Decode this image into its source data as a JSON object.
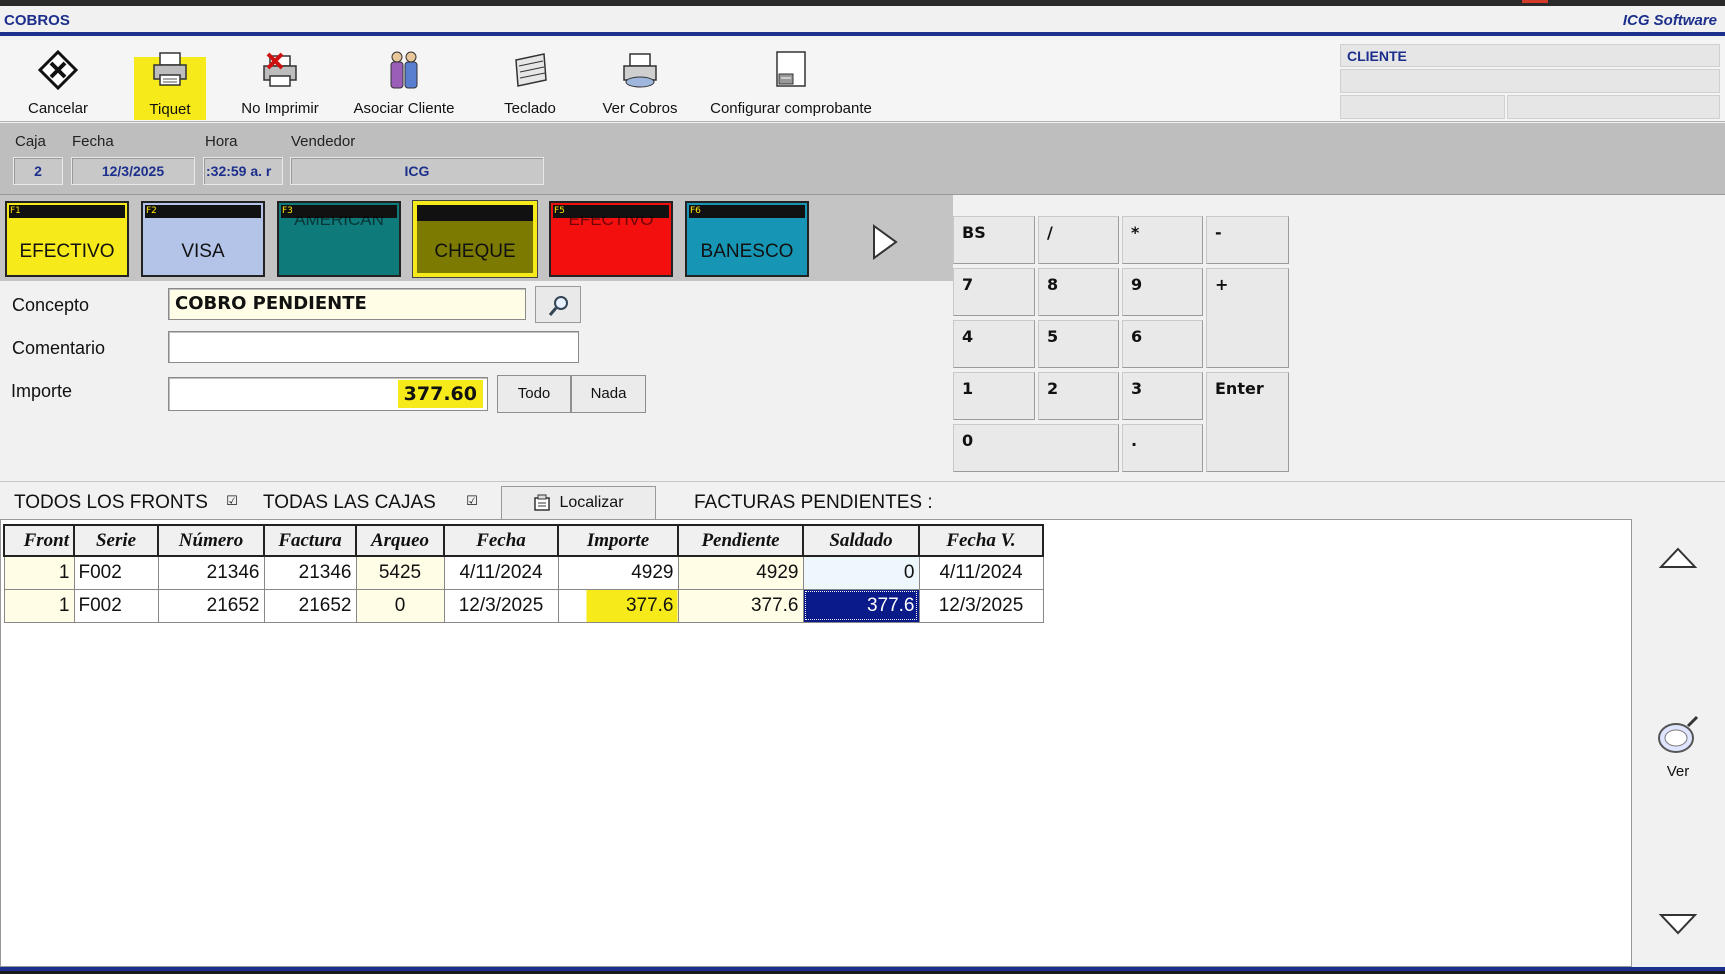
{
  "window": {
    "title": "COBROS",
    "brand": "ICG Software"
  },
  "toolbar": {
    "cancelar": "Cancelar",
    "tiquet": "Tiquet",
    "no_imprimir": "No Imprimir",
    "asociar_cliente": "Asociar Cliente",
    "teclado": "Teclado",
    "ver_cobros": "Ver Cobros",
    "configurar": "Configurar comprobante",
    "active": "tiquet"
  },
  "cliente": {
    "label": "CLIENTE"
  },
  "info": {
    "caja_label": "Caja",
    "caja": "2",
    "fecha_label": "Fecha",
    "fecha": "12/3/2025",
    "hora_label": "Hora",
    "hora": ":32:59 a. r",
    "vendedor_label": "Vendedor",
    "vendedor": "ICG"
  },
  "payments": [
    {
      "key": "F1",
      "label": "EFECTIVO",
      "ghost": "",
      "color": "#f6ea1a",
      "icon": ""
    },
    {
      "key": "F2",
      "label": "VISA",
      "ghost": "",
      "color": "#b4c4e8",
      "icon": ""
    },
    {
      "key": "F3",
      "label": "",
      "ghost": "AMERICAN",
      "color": "#0f7a7a",
      "icon": ""
    },
    {
      "key": "",
      "label": "CHEQUE",
      "ghost": "",
      "color": "#7c7a00",
      "icon": ""
    },
    {
      "key": "F5",
      "label": "",
      "ghost": "EFECTIVO",
      "color": "#f40f0f",
      "icon": ""
    },
    {
      "key": "F6",
      "label": "BANESCO",
      "ghost": "",
      "color": "#1696b4",
      "icon": ""
    }
  ],
  "form": {
    "concepto_label": "Concepto",
    "concepto_value": "COBRO PENDIENTE",
    "comentario_label": "Comentario",
    "comentario_value": "",
    "importe_label": "Importe",
    "importe_value": "377.60",
    "todo": "Todo",
    "nada": "Nada"
  },
  "keypad": {
    "bs": "BS",
    "div": "/",
    "mul": "*",
    "minus": "-",
    "k7": "7",
    "k8": "8",
    "k9": "9",
    "plus": "+",
    "k4": "4",
    "k5": "5",
    "k6": "6",
    "k1": "1",
    "k2": "2",
    "k3": "3",
    "enter": "Enter",
    "k0": "0",
    "dot": "."
  },
  "filters": {
    "todos_fronts": "TODOS LOS FRONTS",
    "todos_fronts_checked": "☑",
    "todas_cajas": "TODAS LAS CAJAS",
    "todas_cajas_checked": "☑",
    "localizar": "Localizar",
    "facturas_pendientes": "FACTURAS PENDIENTES :"
  },
  "grid": {
    "headers": [
      "Front",
      "Serie",
      "Número",
      "Factura",
      "Arqueo",
      "Fecha",
      "Importe",
      "Pendiente",
      "Saldado",
      "Fecha V."
    ],
    "rows": [
      [
        "1",
        "F002",
        "21346",
        "21346",
        "5425",
        "4/11/2024",
        "4929",
        "4929",
        "0",
        "4/11/2024"
      ],
      [
        "1",
        "F002",
        "21652",
        "21652",
        "0",
        "12/3/2025",
        "377.6",
        "377.6",
        "377.6",
        "12/3/2025"
      ]
    ]
  },
  "side": {
    "ver": "Ver"
  }
}
